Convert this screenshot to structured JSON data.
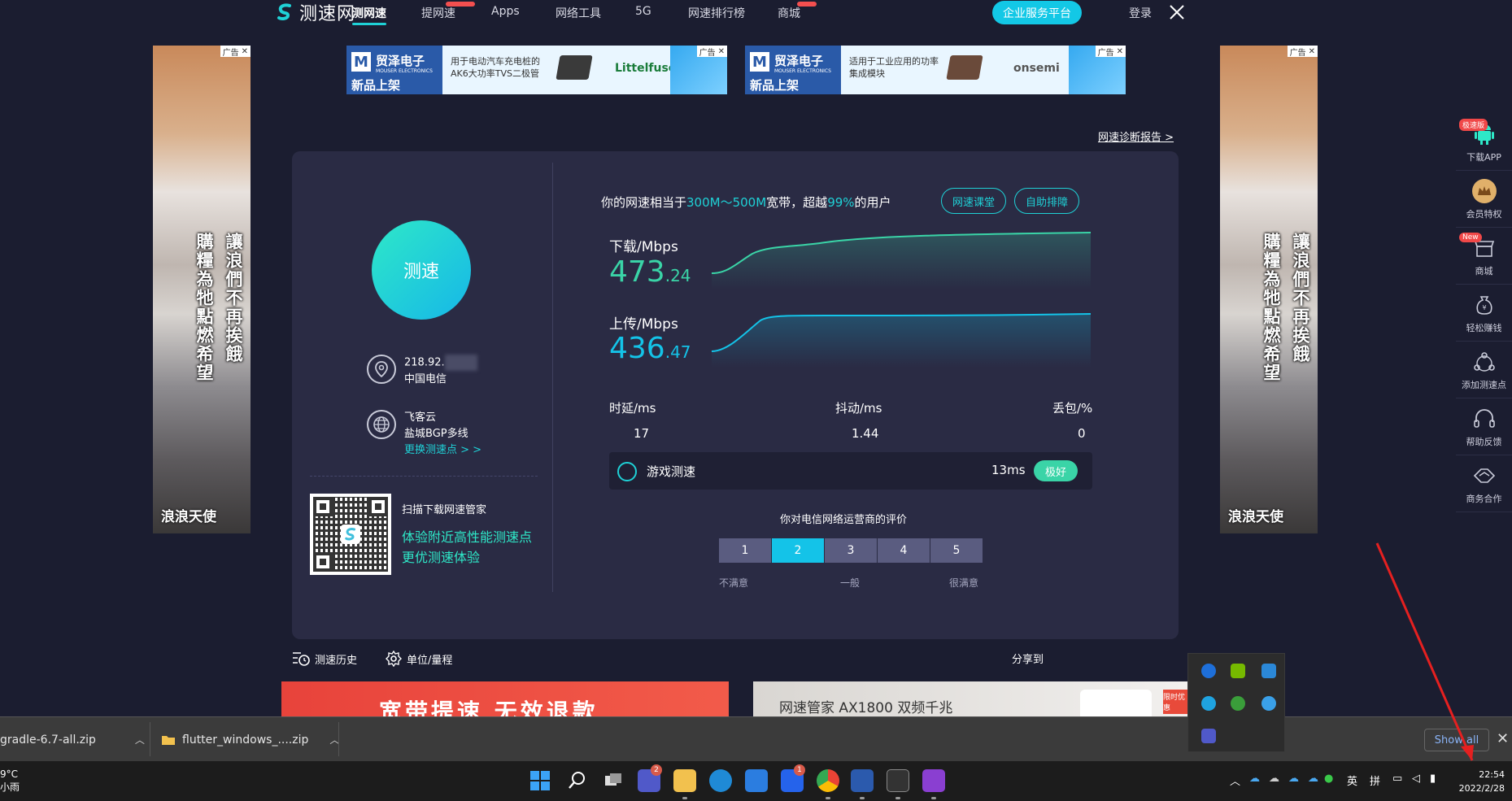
{
  "nav": {
    "brand": "测速网",
    "items": [
      "测网速",
      "提网速",
      "Apps",
      "网络工具",
      "5G",
      "网速排行榜",
      "商城"
    ],
    "enterprise": "企业服务平台",
    "login": "登录"
  },
  "ads": {
    "tag": "广告",
    "side_text_cols": [
      "讓浪們不再挨餓",
      "購糧為牠點燃希望"
    ],
    "side_brand": "浪浪天使",
    "top": [
      {
        "brand": "贸泽电子",
        "brand_sub": "MOUSER ELECTRONICS",
        "new": "新品上架",
        "copy": "用于电动汽车充电桩的AK6大功率TVS二极管",
        "vendor": "Littelfuse"
      },
      {
        "brand": "贸泽电子",
        "brand_sub": "MOUSER ELECTRONICS",
        "new": "新品上架",
        "copy": "适用于工业应用的功率集成模块",
        "vendor": "onsemi"
      }
    ]
  },
  "report_link": "网速诊断报告 >",
  "left": {
    "speed_button": "测速",
    "ip": "218.92.",
    "isp": "中国电信",
    "node_name": "飞客云",
    "node_desc": "盐城BGP多线",
    "change_node": "更换测速点 > >",
    "scan_title": "扫描下载网速管家",
    "scan_line1": "体验附近高性能测速点",
    "scan_line2": "更优测速体验"
  },
  "summary": {
    "prefix": "你的网速相当于",
    "band": "300M～500M",
    "mid": "宽带，超越",
    "percent": "99%",
    "suffix": "的用户",
    "btn_class": "网速课堂",
    "btn_fix": "自助排障"
  },
  "download": {
    "label": "下载/Mbps",
    "int": "473",
    "dec": ".24",
    "color": "#3ad4a7"
  },
  "upload": {
    "label": "上传/Mbps",
    "int": "436",
    "dec": ".47",
    "color": "#14c3e8"
  },
  "latency": {
    "label": "时延/ms",
    "value": "17"
  },
  "jitter": {
    "label": "抖动/ms",
    "value": "1.44"
  },
  "loss": {
    "label": "丢包/%",
    "value": "0"
  },
  "game": {
    "label": "游戏测速",
    "ms": "13ms",
    "badge": "极好"
  },
  "rating": {
    "title": "你对电信网络运营商的评价",
    "options": [
      "1",
      "2",
      "3",
      "4",
      "5"
    ],
    "selected": "2",
    "low": "不满意",
    "mid": "一般",
    "high": "很满意"
  },
  "tools": {
    "history": "测速历史",
    "unit": "单位/量程",
    "share": "分享到"
  },
  "banners": {
    "left": "宽带提速 无效退款",
    "right": "网速管家 AX1800 双频千兆",
    "right_tag": "限时优惠"
  },
  "sidebar": [
    {
      "label": "下载APP",
      "badge": "极速版"
    },
    {
      "label": "会员特权",
      "badge": ""
    },
    {
      "label": "商城",
      "badge": "New"
    },
    {
      "label": "轻松赚钱",
      "badge": ""
    },
    {
      "label": "添加测速点",
      "badge": ""
    },
    {
      "label": "帮助反馈",
      "badge": ""
    },
    {
      "label": "商务合作",
      "badge": ""
    }
  ],
  "downloads": [
    {
      "name": "gradle-6.7-all.zip"
    },
    {
      "name": "flutter_windows_....zip"
    }
  ],
  "show_all": "Show all",
  "taskbar": {
    "temp": "9°C",
    "weather": "小雨",
    "ime1": "英",
    "ime2": "拼",
    "time": "22:54",
    "date": "2022/2/28",
    "teams_badge": "2",
    "todo_badge": "1"
  }
}
